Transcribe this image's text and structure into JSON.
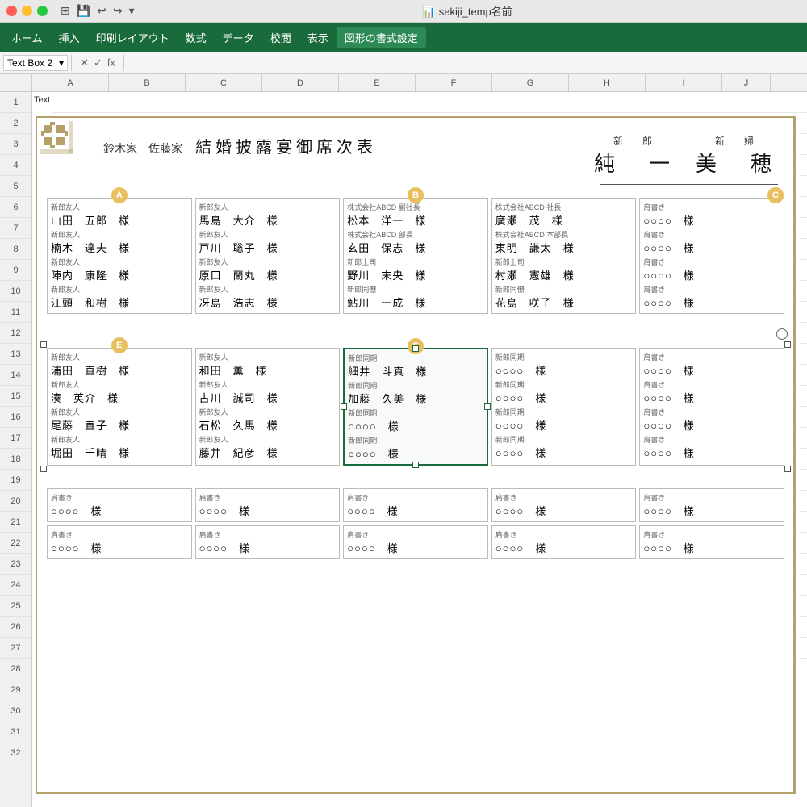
{
  "titlebar": {
    "title": "sekiji_temp名前",
    "icon": "📊"
  },
  "menubar": {
    "items": [
      "ホーム",
      "挿入",
      "印刷レイアウト",
      "数式",
      "データ",
      "校閲",
      "表示",
      "図形の書式設定"
    ]
  },
  "formulabar": {
    "cell_ref": "Text Box 2",
    "formula_symbol": "fx",
    "formula_value": ""
  },
  "columns": [
    "A",
    "B",
    "C",
    "D",
    "E",
    "F",
    "G",
    "H",
    "I",
    "J"
  ],
  "rows": [
    1,
    2,
    3,
    4,
    5,
    6,
    7,
    8,
    9,
    10,
    11,
    12,
    13,
    14,
    15,
    16,
    17,
    18,
    19,
    20,
    21,
    22,
    23,
    24,
    25,
    26,
    27,
    28,
    29,
    30,
    31,
    32
  ],
  "document": {
    "title": "結婚披露宴御席次表",
    "families": "鈴木家　佐藤家",
    "groom_label": "新　郎",
    "bride_label": "新　婦",
    "groom_name": "純　一",
    "bride_name": "美　穂",
    "table_sections": [
      {
        "tables": [
          {
            "label_a": "新郎友人",
            "guests": [
              {
                "role": "新郎友人",
                "name": "山田　五郎　様"
              },
              {
                "role": "新郎友人",
                "name": "楠木　達夫　様"
              },
              {
                "role": "新郎友人",
                "name": "陣内　康隆　様"
              },
              {
                "role": "新郎友人",
                "name": "江頭　和樹　様"
              }
            ],
            "badge": "A"
          },
          {
            "guests": [
              {
                "role": "新郎友人",
                "name": "馬島　大介　様"
              },
              {
                "role": "新郎友人",
                "name": "戸川　聡子　様"
              },
              {
                "role": "新郎友人",
                "name": "原口　蘭丸　様"
              },
              {
                "role": "新郎友人",
                "name": "冴島　浩志　様"
              }
            ]
          },
          {
            "guests": [
              {
                "role": "株式会社ABCD 副社長",
                "name": "松本　洋一　様"
              },
              {
                "role": "株式会社ABCD 部長",
                "name": "玄田　保志　様"
              },
              {
                "role": "新郎上司",
                "name": "野川　末央　様"
              },
              {
                "role": "新郎同僚",
                "name": "鮎川　一成　様"
              }
            ],
            "badge": "B"
          },
          {
            "guests": [
              {
                "role": "株式会社ABCD 社長",
                "name": "廣瀬　茂　様"
              },
              {
                "role": "株式会社ABCD 本部長",
                "name": "東明　謙太　様"
              },
              {
                "role": "新郎上司",
                "name": "村瀬　憲雄　様"
              },
              {
                "role": "新郎同僚",
                "name": "花島　咲子　様"
              }
            ]
          },
          {
            "guests": [
              {
                "role": "肩書き",
                "name": "○○○○　様"
              },
              {
                "role": "肩書き",
                "name": "○○○○　様"
              },
              {
                "role": "肩書き",
                "name": "○○○○　様"
              },
              {
                "role": "肩書き",
                "name": "○○○○　様"
              }
            ]
          }
        ]
      },
      {
        "tables": [
          {
            "guests": [
              {
                "role": "新郎友人",
                "name": "浦田　直樹　様"
              },
              {
                "role": "新郎友人",
                "name": "湊　英介　様"
              },
              {
                "role": "新郎友人",
                "name": "尾藤　直子　様"
              },
              {
                "role": "新郎友人",
                "name": "堀田　千晴　様"
              }
            ],
            "badge": "E"
          },
          {
            "guests": [
              {
                "role": "新郎友人",
                "name": "和田　薫　様"
              },
              {
                "role": "新郎友人",
                "name": "古川　誠司　様"
              },
              {
                "role": "新郎友人",
                "name": "石松　久馬　様"
              },
              {
                "role": "新郎友人",
                "name": "藤井　紀彦　様"
              }
            ]
          },
          {
            "guests": [
              {
                "role": "新郎同期",
                "name": "細井　斗真　様"
              },
              {
                "role": "新郎同期",
                "name": "加藤　久美　様"
              },
              {
                "role": "新郎同期",
                "name": "○○○○　様"
              },
              {
                "role": "新郎同期",
                "name": "○○○○　様"
              }
            ],
            "badge": "F"
          },
          {
            "guests": [
              {
                "role": "新郎同期",
                "name": "○○○○　様"
              },
              {
                "role": "新郎同期",
                "name": "○○○○　様"
              },
              {
                "role": "新郎同期",
                "name": "○○○○　様"
              },
              {
                "role": "新郎同期",
                "name": "○○○○　様"
              }
            ]
          },
          {
            "guests": [
              {
                "role": "肩書き",
                "name": "○○○○　様"
              },
              {
                "role": "肩書き",
                "name": "○○○○　様"
              },
              {
                "role": "肩書き",
                "name": "○○○○　様"
              },
              {
                "role": "肩書き",
                "name": "○○○○　様"
              }
            ]
          }
        ]
      },
      {
        "tables": [
          {
            "role": "肩書き",
            "name": "○○○○　様"
          },
          {
            "role": "肩書き",
            "name": "○○○○　様"
          },
          {
            "role": "肩書き",
            "name": "○○○○　様"
          },
          {
            "role": "肩書き",
            "name": "○○○○　様"
          },
          {
            "role": "肩書き",
            "name": "○○○○　様"
          }
        ]
      }
    ]
  }
}
